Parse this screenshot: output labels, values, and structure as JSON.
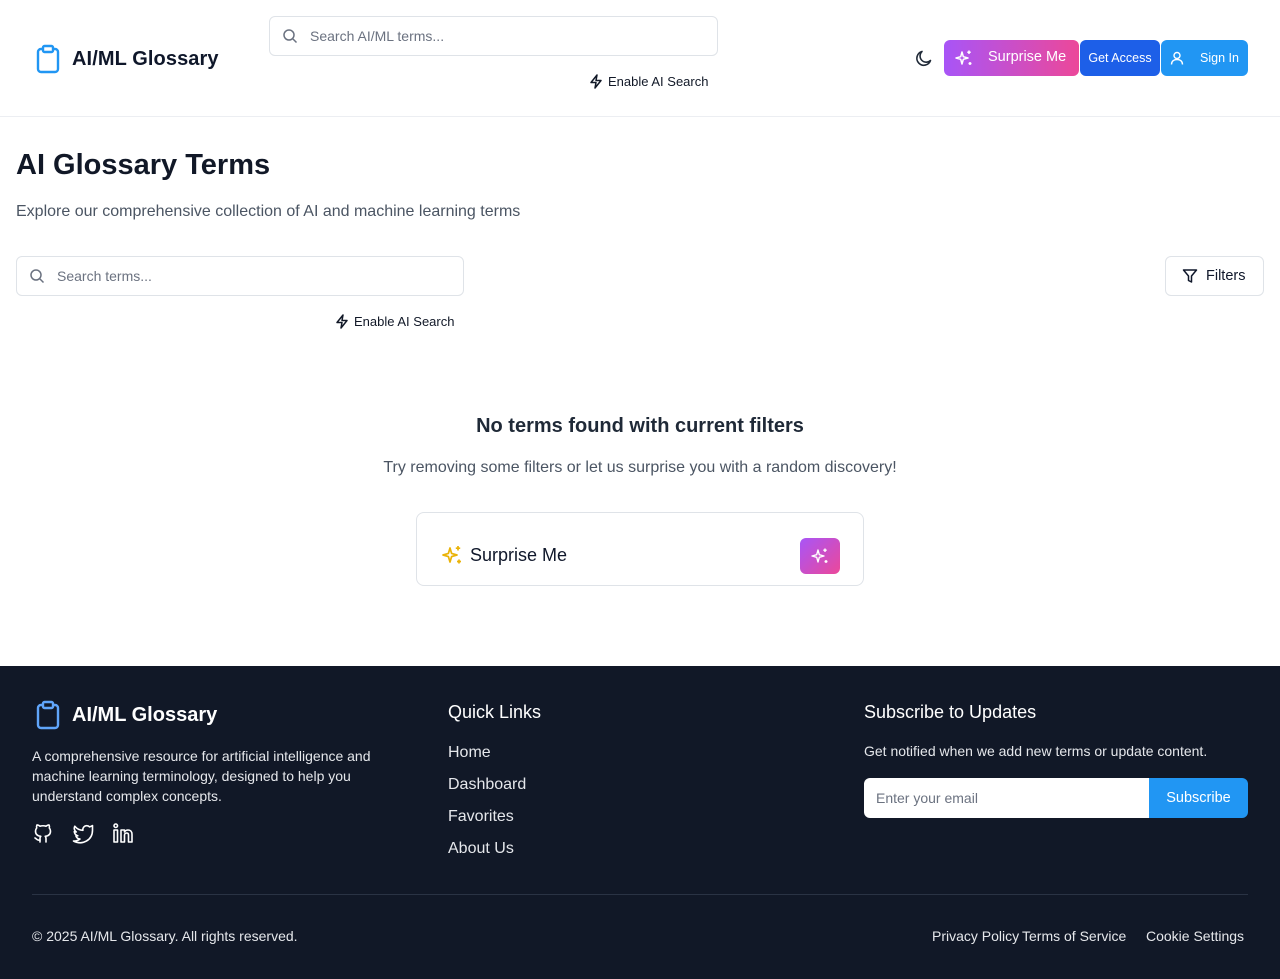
{
  "header": {
    "logo_text": "AI/ML Glossary",
    "search_placeholder": "Search AI/ML terms...",
    "ai_search_label": "Enable AI Search",
    "surprise_label": "Surprise Me",
    "access_label": "Get Access",
    "signin_label": "Sign In"
  },
  "main": {
    "title": "AI Glossary Terms",
    "subtitle": "Explore our comprehensive collection of AI and machine learning terms",
    "search_placeholder": "Search terms...",
    "ai_search_label": "Enable AI Search",
    "filters_label": "Filters",
    "empty_title": "No terms found with current filters",
    "empty_subtitle": "Try removing some filters or let us surprise you with a random discovery!",
    "surprise_card_label": "Surprise Me"
  },
  "footer": {
    "logo_text": "AI/ML Glossary",
    "description": "A comprehensive resource for artificial intelligence and machine learning terminology, designed to help you understand complex concepts.",
    "quick_links_title": "Quick Links",
    "quick_links": [
      "Home",
      "Dashboard",
      "Favorites",
      "About Us"
    ],
    "subscribe_title": "Subscribe to Updates",
    "subscribe_desc": "Get notified when we add new terms or update content.",
    "email_placeholder": "Enter your email",
    "subscribe_label": "Subscribe",
    "copyright": "© 2025 AI/ML Glossary. All rights reserved.",
    "privacy": "Privacy Policy",
    "terms": "Terms of Service",
    "cookies": "Cookie Settings"
  },
  "colors": {
    "brand_blue": "#2196f3",
    "access_blue": "#1d5fe8",
    "gradient_from": "#a855f7",
    "gradient_to": "#ec4899",
    "footer_bg": "#111827"
  }
}
